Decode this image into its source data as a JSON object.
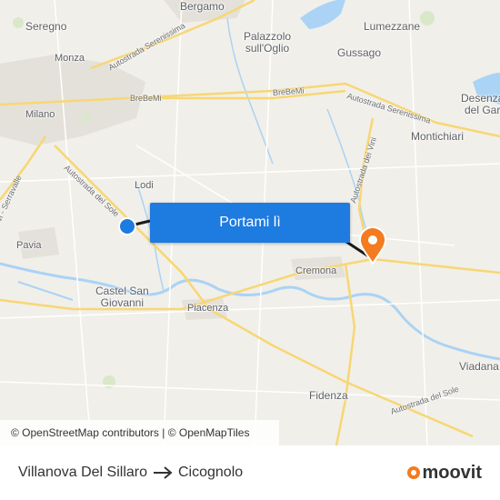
{
  "map": {
    "places": [
      {
        "id": "bergamo",
        "label": "Bergamo"
      },
      {
        "id": "seregno",
        "label": "Seregno"
      },
      {
        "id": "monza",
        "label": "Monza"
      },
      {
        "id": "milano",
        "label": "Milano"
      },
      {
        "id": "palazzolo",
        "label": "Palazzolo\nsull'Oglio"
      },
      {
        "id": "lumezzane",
        "label": "Lumezzane"
      },
      {
        "id": "gussago",
        "label": "Gussago"
      },
      {
        "id": "desenzano",
        "label": "Desenza\ndel Gar"
      },
      {
        "id": "montichiari",
        "label": "Montichiari"
      },
      {
        "id": "lodi",
        "label": "Lodi"
      },
      {
        "id": "pavia",
        "label": "Pavia"
      },
      {
        "id": "castel",
        "label": "Castel San\nGiovanni"
      },
      {
        "id": "piacenza",
        "label": "Piacenza"
      },
      {
        "id": "cremona",
        "label": "Cremona"
      },
      {
        "id": "fidenza",
        "label": "Fidenza"
      },
      {
        "id": "viadana",
        "label": "Viadana"
      }
    ],
    "roads": [
      {
        "id": "a4-west",
        "label": "Autostrada Serenissima"
      },
      {
        "id": "a4-east",
        "label": "Autostrada Serenissima"
      },
      {
        "id": "brebemi-1",
        "label": "BreBeMi"
      },
      {
        "id": "brebemi-2",
        "label": "BreBeMi"
      },
      {
        "id": "a1-north",
        "label": "Autostrada del Sole"
      },
      {
        "id": "a1-south",
        "label": "Autostrada del Sole"
      },
      {
        "id": "a21",
        "label": "Autostrada dei Vini"
      },
      {
        "id": "serravalle",
        "label": "vi - Serravalle"
      }
    ],
    "origin_marker": "origin-dot-icon",
    "destination_marker": "destination-pin-icon",
    "colors": {
      "route": "#1a1a1a",
      "origin": "#1e7bdf",
      "destination": "#f47b20",
      "water": "#aad3f5",
      "urban": "#ddd9d0",
      "road_major": "#f7d774"
    }
  },
  "cta": {
    "label": "Portami lì"
  },
  "attribution": {
    "text": "© OpenStreetMap contributors | © OpenMapTiles"
  },
  "footer": {
    "origin": "Villanova Del Sillaro",
    "destination": "Cicognolo",
    "arrow_icon": "right-arrow-icon",
    "brand": "moovit"
  }
}
